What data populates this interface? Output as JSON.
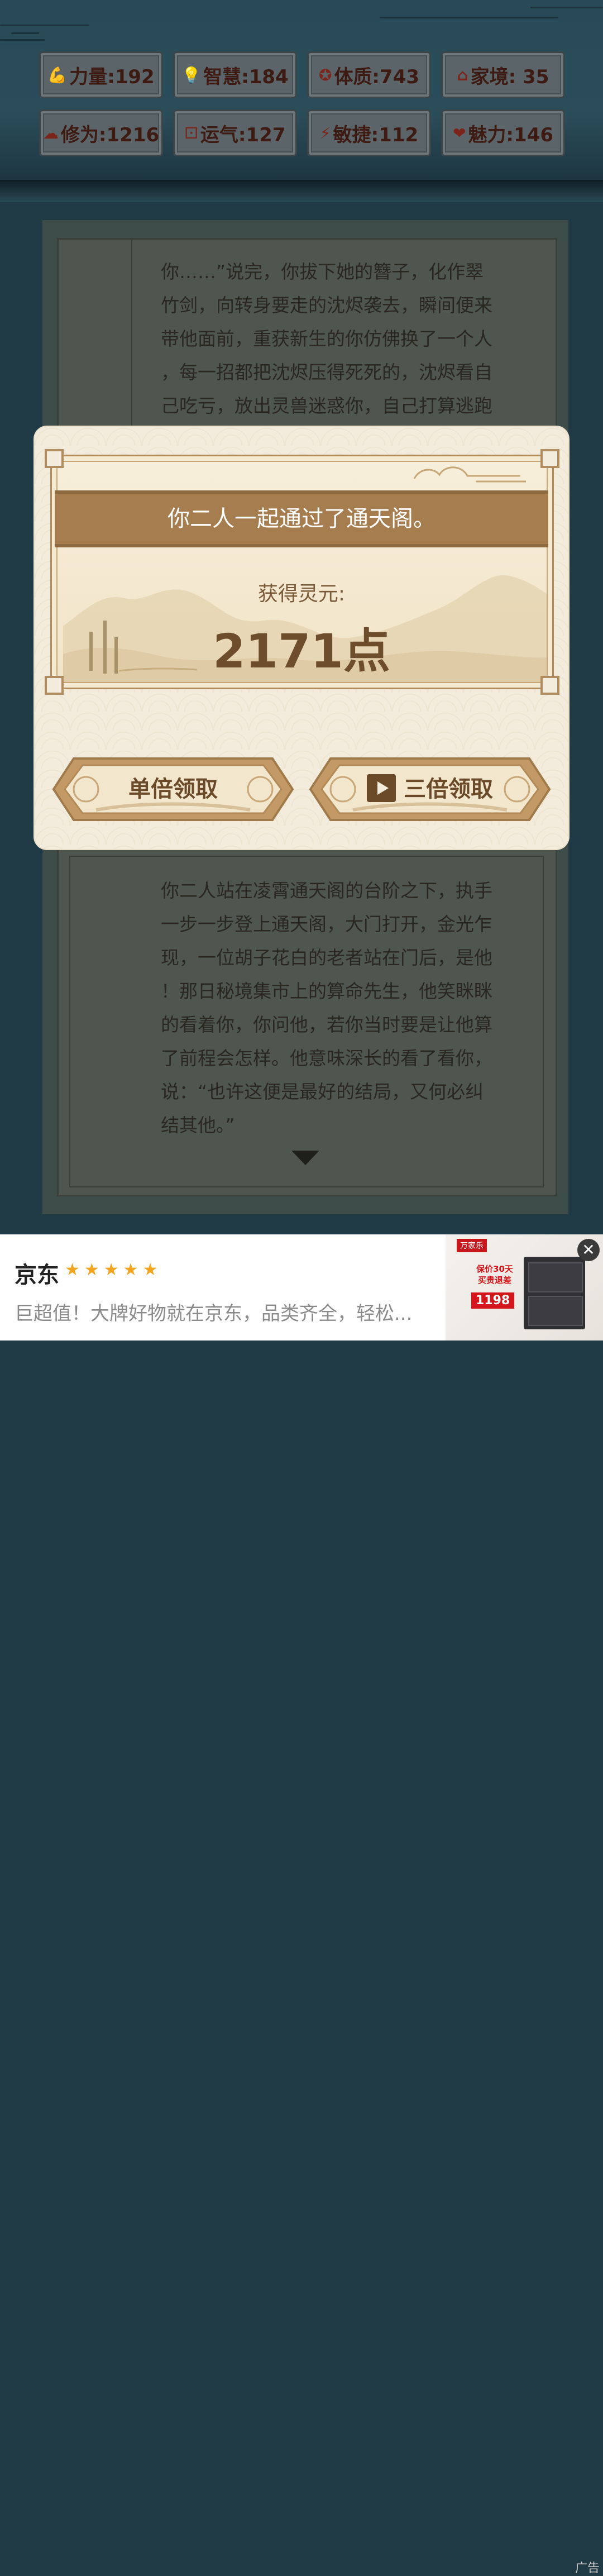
{
  "stats": [
    {
      "icon": "arm-icon",
      "glyph": "💪",
      "label": "力量:192"
    },
    {
      "icon": "bulb-icon",
      "glyph": "💡",
      "label": "智慧:184"
    },
    {
      "icon": "body-icon",
      "glyph": "✪",
      "label": "体质:743"
    },
    {
      "icon": "home-icon",
      "glyph": "⌂",
      "label": "家境: 35"
    },
    {
      "icon": "cloud-icon",
      "glyph": "☁",
      "label": "修为:1216"
    },
    {
      "icon": "dice-icon",
      "glyph": "⚀",
      "label": "运气:127"
    },
    {
      "icon": "lightning-icon",
      "glyph": "⚡",
      "label": "敏捷:112"
    },
    {
      "icon": "heart-icon",
      "glyph": "❤",
      "label": "魅力:146"
    }
  ],
  "story_top": [
    "你……”说完，你拔下她的簪子，化作翠",
    "竹剑，向转身要走的沈烬袭去，瞬间便来",
    "带他面前，重获新生的你仿佛换了一个人",
    "，每一招都把沈烬压得死死的，沈烬看自",
    "己吃亏，放出灵兽迷惑你，自己打算逃跑"
  ],
  "story_bottom": [
    "你二人站在凌霄通天阁的台阶之下，执手",
    "一步一步登上通天阁，大门打开，金光乍",
    "现，一位胡子花白的老者站在门后，是他",
    "！那日秘境集市上的算命先生，他笑眯眯",
    "的看着你，你问他，若你当时要是让他算",
    "了前程会怎样。他意味深长的看了看你，",
    "说：“也许这便是最好的结局，又何必纠",
    "结其他。”"
  ],
  "modal": {
    "banner": "你二人一起通过了通天阁。",
    "reward_label": "获得灵元:",
    "reward_value": "2171点",
    "btn_single": "单倍领取",
    "btn_triple": "三倍领取"
  },
  "ad": {
    "brand": "京东",
    "stars": "★★★★★",
    "desc": "巨超值！大牌好物就在京东，品类齐全，轻松...",
    "tag": "广告",
    "close": "✕",
    "img_top": "万家乐",
    "img_promo": "保价30天 买贵退差",
    "img_price": "1198"
  }
}
